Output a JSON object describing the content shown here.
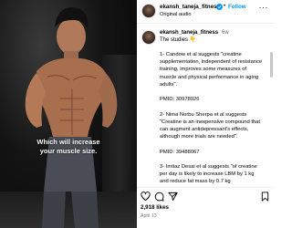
{
  "post": {
    "media": {
      "overlay_line_1": "Which will increase",
      "overlay_line_2": "your muscle size."
    },
    "header": {
      "username": "ekansh_taneja_fitness",
      "separator": "•",
      "follow_label": "Follow",
      "audio_label": "Original audio",
      "more_label": "···"
    },
    "caption": {
      "username": "ekansh_taneja_fitness",
      "intro": "The studies",
      "emoji": "👇",
      "time": "6w",
      "paragraphs": [
        "1- Candow et al suggests \"creatine supplementation, independent of resistance training, improves some measures of muscle and physical performance in aging adults\".",
        "PMID: 30978926",
        "2- Nima Norbu Sherpa et al suggests \"Creatine is an inexpensive compound that can augment antidepressant's effects, although more trials are needed\".",
        "PMID: 39488067",
        "3- Imtiaz Desai et al suggests \"of creatine per day is likely to increase LBM by 1 kg and reduce fat mass by 0.7 kg"
      ]
    },
    "actions": {
      "like_icon": "heart-icon",
      "comment_icon": "comment-icon",
      "share_icon": "send-icon",
      "save_icon": "bookmark-icon"
    },
    "likes": "2,918 likes",
    "date": "April 13"
  },
  "colors": {
    "link_blue": "#0095f6",
    "verified_blue": "#0095f6",
    "muted_text": "#737373"
  }
}
